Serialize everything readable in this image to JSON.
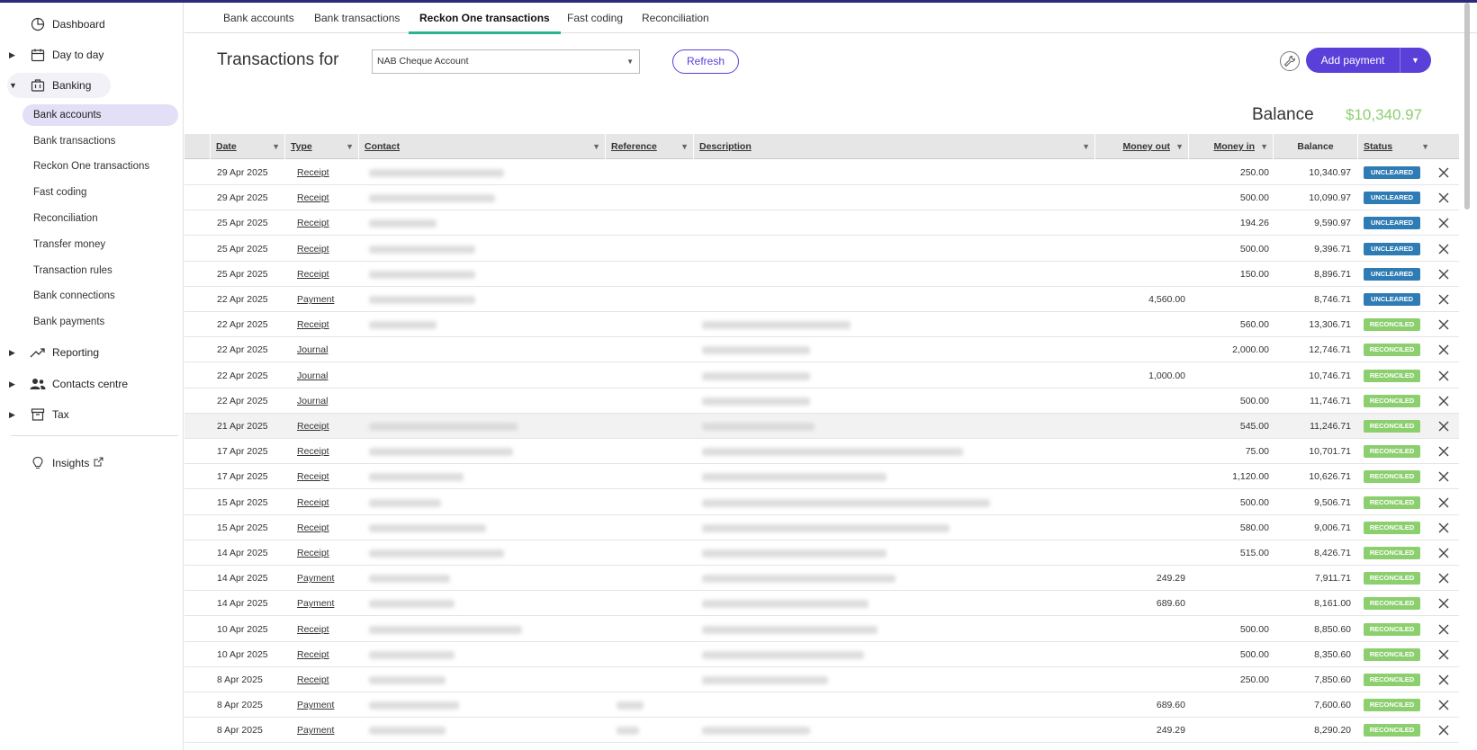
{
  "sidebar": {
    "dashboard": "Dashboard",
    "day_to_day": "Day to day",
    "banking": "Banking",
    "banking_items": [
      "Bank accounts",
      "Bank transactions",
      "Reckon One transactions",
      "Fast coding",
      "Reconciliation",
      "Transfer money",
      "Transaction rules",
      "Bank connections",
      "Bank payments"
    ],
    "reporting": "Reporting",
    "contacts": "Contacts centre",
    "tax": "Tax",
    "insights": "Insights"
  },
  "tabs": [
    "Bank accounts",
    "Bank transactions",
    "Reckon One transactions",
    "Fast coding",
    "Reconciliation"
  ],
  "header": {
    "title": "Transactions for",
    "account": "NAB Cheque Account",
    "refresh": "Refresh",
    "add_payment": "Add payment",
    "balance_label": "Balance",
    "balance_value": "$10,340.97"
  },
  "columns": {
    "date": "Date",
    "type": "Type",
    "contact": "Contact",
    "reference": "Reference",
    "description": "Description",
    "money_out": "Money out",
    "money_in": "Money in",
    "balance": "Balance",
    "status": "Status"
  },
  "rows": [
    {
      "date": "29 Apr 2025",
      "type": "Receipt",
      "out": "",
      "in": "250.00",
      "balance": "10,340.97",
      "status": "UNCLEARED"
    },
    {
      "date": "29 Apr 2025",
      "type": "Receipt",
      "out": "",
      "in": "500.00",
      "balance": "10,090.97",
      "status": "UNCLEARED"
    },
    {
      "date": "25 Apr 2025",
      "type": "Receipt",
      "out": "",
      "in": "194.26",
      "balance": "9,590.97",
      "status": "UNCLEARED"
    },
    {
      "date": "25 Apr 2025",
      "type": "Receipt",
      "out": "",
      "in": "500.00",
      "balance": "9,396.71",
      "status": "UNCLEARED"
    },
    {
      "date": "25 Apr 2025",
      "type": "Receipt",
      "out": "",
      "in": "150.00",
      "balance": "8,896.71",
      "status": "UNCLEARED"
    },
    {
      "date": "22 Apr 2025",
      "type": "Payment",
      "out": "4,560.00",
      "in": "",
      "balance": "8,746.71",
      "status": "UNCLEARED"
    },
    {
      "date": "22 Apr 2025",
      "type": "Receipt",
      "out": "",
      "in": "560.00",
      "balance": "13,306.71",
      "status": "RECONCILED"
    },
    {
      "date": "22 Apr 2025",
      "type": "Journal",
      "out": "",
      "in": "2,000.00",
      "balance": "12,746.71",
      "status": "RECONCILED"
    },
    {
      "date": "22 Apr 2025",
      "type": "Journal",
      "out": "1,000.00",
      "in": "",
      "balance": "10,746.71",
      "status": "RECONCILED"
    },
    {
      "date": "22 Apr 2025",
      "type": "Journal",
      "out": "",
      "in": "500.00",
      "balance": "11,746.71",
      "status": "RECONCILED"
    },
    {
      "date": "21 Apr 2025",
      "type": "Receipt",
      "out": "",
      "in": "545.00",
      "balance": "11,246.71",
      "status": "RECONCILED"
    },
    {
      "date": "17 Apr 2025",
      "type": "Receipt",
      "out": "",
      "in": "75.00",
      "balance": "10,701.71",
      "status": "RECONCILED"
    },
    {
      "date": "17 Apr 2025",
      "type": "Receipt",
      "out": "",
      "in": "1,120.00",
      "balance": "10,626.71",
      "status": "RECONCILED"
    },
    {
      "date": "15 Apr 2025",
      "type": "Receipt",
      "out": "",
      "in": "500.00",
      "balance": "9,506.71",
      "status": "RECONCILED"
    },
    {
      "date": "15 Apr 2025",
      "type": "Receipt",
      "out": "",
      "in": "580.00",
      "balance": "9,006.71",
      "status": "RECONCILED"
    },
    {
      "date": "14 Apr 2025",
      "type": "Receipt",
      "out": "",
      "in": "515.00",
      "balance": "8,426.71",
      "status": "RECONCILED"
    },
    {
      "date": "14 Apr 2025",
      "type": "Payment",
      "out": "249.29",
      "in": "",
      "balance": "7,911.71",
      "status": "RECONCILED"
    },
    {
      "date": "14 Apr 2025",
      "type": "Payment",
      "out": "689.60",
      "in": "",
      "balance": "8,161.00",
      "status": "RECONCILED"
    },
    {
      "date": "10 Apr 2025",
      "type": "Receipt",
      "out": "",
      "in": "500.00",
      "balance": "8,850.60",
      "status": "RECONCILED"
    },
    {
      "date": "10 Apr 2025",
      "type": "Receipt",
      "out": "",
      "in": "500.00",
      "balance": "8,350.60",
      "status": "RECONCILED"
    },
    {
      "date": "8 Apr 2025",
      "type": "Receipt",
      "out": "",
      "in": "250.00",
      "balance": "7,850.60",
      "status": "RECONCILED"
    },
    {
      "date": "8 Apr 2025",
      "type": "Payment",
      "out": "689.60",
      "in": "",
      "balance": "7,600.60",
      "status": "RECONCILED"
    },
    {
      "date": "8 Apr 2025",
      "type": "Payment",
      "out": "249.29",
      "in": "",
      "balance": "8,290.20",
      "status": "RECONCILED"
    }
  ],
  "colors": {
    "accent": "#5a3fd9",
    "tab_active": "#2bb193",
    "uncleared": "#2f7cb5",
    "reconciled": "#8ccf6f",
    "balance": "#8ccf6f"
  }
}
